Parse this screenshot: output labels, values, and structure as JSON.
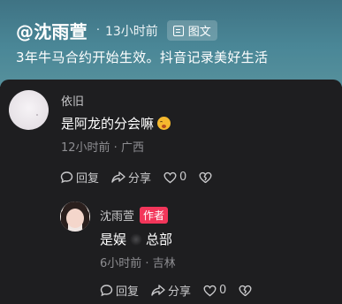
{
  "post": {
    "author_handle": "@沈雨萱",
    "dot": "·",
    "time": "13小时前",
    "type_tag": "图文",
    "caption": "3年牛马合约开始生效。抖音记录美好生活"
  },
  "comments": [
    {
      "user": "依旧",
      "text": "是阿龙的分会嘛",
      "emoji": "astonished-face",
      "meta": "12小时前 · 广西",
      "reply_label": "回复",
      "share_label": "分享",
      "like_count": "0"
    }
  ],
  "reply": {
    "user": "沈雨萱",
    "badge": "作者",
    "text_part1": "是娱",
    "text_part2": "总部",
    "meta": "6小时前 · 吉林",
    "reply_label": "回复",
    "share_label": "分享",
    "like_count": "0"
  },
  "colors": {
    "hero_bg": "#4a8797",
    "panel_bg": "#1e1e20",
    "author_badge": "#f2365a"
  }
}
